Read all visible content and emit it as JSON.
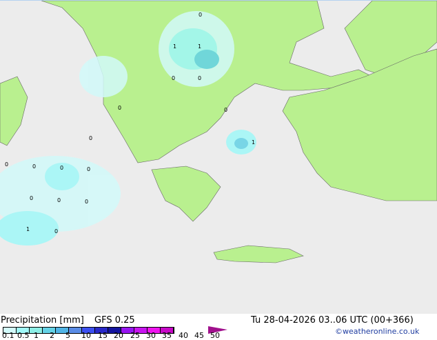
{
  "title": "Precipitation [mm]",
  "model": "GFS 0.25",
  "datetime": "Tu 28-04-2026 03..06 UTC (00+366)",
  "credit": "©weatheronline.co.uk",
  "legend": {
    "ticks": [
      "0.1",
      "0.5",
      "1",
      "2",
      "5",
      "10",
      "15",
      "20",
      "25",
      "30",
      "35",
      "40",
      "45",
      "50"
    ],
    "colors": [
      "#d2fafa",
      "#a0f8f8",
      "#8ceee6",
      "#64d2e6",
      "#50b4e6",
      "#5a8ce6",
      "#3c50f0",
      "#2828c8",
      "#14149e",
      "#9614f0",
      "#c814f0",
      "#f014f0",
      "#c80ac8"
    ]
  },
  "map_labels": [
    "0",
    "1",
    "1",
    "0",
    "0",
    "0",
    "0",
    "1",
    "0",
    "0",
    "0",
    "0",
    "0",
    "0",
    "0",
    "0",
    "1",
    "0"
  ]
}
